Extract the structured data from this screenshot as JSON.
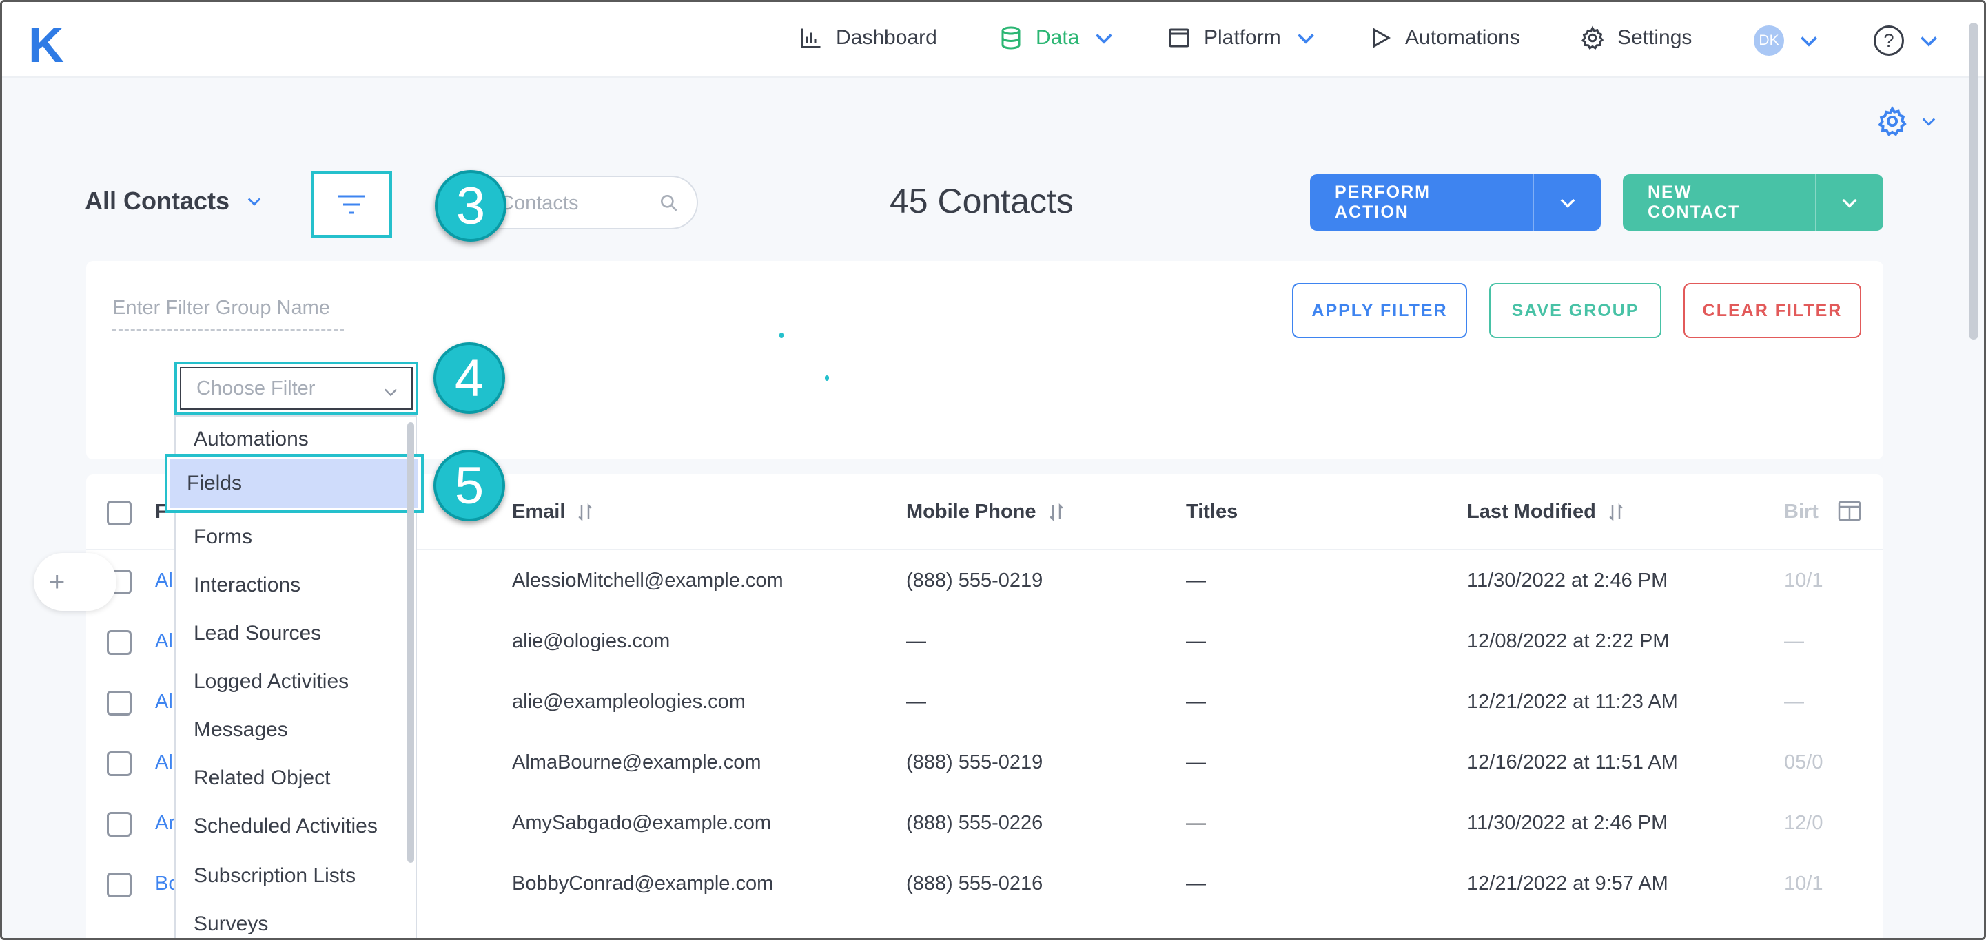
{
  "nav": {
    "logo": "K",
    "items": [
      {
        "label": "Dashboard"
      },
      {
        "label": "Data"
      },
      {
        "label": "Platform"
      },
      {
        "label": "Automations"
      },
      {
        "label": "Settings"
      }
    ],
    "avatar_initials": "DK",
    "help_glyph": "?",
    "active_color": "#2bb673",
    "accent_color": "#2f7be5"
  },
  "header": {
    "view_label": "All Contacts",
    "search_placeholder": "Contacts",
    "count_label": "45 Contacts",
    "perform_action": "PERFORM ACTION",
    "new_contact": "NEW CONTACT"
  },
  "filter": {
    "group_name_placeholder": "Enter Filter Group Name",
    "apply": "APPLY FILTER",
    "save": "SAVE GROUP",
    "clear": "CLEAR FILTER",
    "choose_placeholder": "Choose Filter",
    "menu": [
      "Automations",
      "Fields",
      "Forms",
      "Interactions",
      "Lead Sources",
      "Logged Activities",
      "Messages",
      "Related Object",
      "Scheduled Activities",
      "Subscription Lists",
      "Surveys"
    ],
    "selected": "Fields"
  },
  "badges": {
    "b3": "3",
    "b4": "4",
    "b5": "5"
  },
  "table": {
    "columns": {
      "name": "F",
      "email": "Email",
      "phone": "Mobile Phone",
      "titles": "Titles",
      "modified": "Last Modified",
      "birth": "Birt"
    },
    "plus": "+",
    "rows": [
      {
        "name": "Al",
        "email": "AlessioMitchell@example.com",
        "phone": "(888) 555-0219",
        "titles": "—",
        "modified": "11/30/2022 at 2:46 PM",
        "birth": "10/1"
      },
      {
        "name": "Al",
        "email": "alie@ologies.com",
        "phone": "—",
        "titles": "—",
        "modified": "12/08/2022 at 2:22 PM",
        "birth": "—"
      },
      {
        "name": "Al",
        "email": "alie@exampleologies.com",
        "phone": "—",
        "titles": "—",
        "modified": "12/21/2022 at 11:23 AM",
        "birth": "—"
      },
      {
        "name": "Al",
        "email": "AlmaBourne@example.com",
        "phone": "(888) 555-0219",
        "titles": "—",
        "modified": "12/16/2022 at 11:51 AM",
        "birth": "05/0"
      },
      {
        "name": "Ar",
        "email": "AmySabgado@example.com",
        "phone": "(888) 555-0226",
        "titles": "—",
        "modified": "11/30/2022 at 2:46 PM",
        "birth": "12/0"
      },
      {
        "name": "Bo",
        "email": "BobbyConrad@example.com",
        "phone": "(888) 555-0216",
        "titles": "—",
        "modified": "12/21/2022 at 9:57 AM",
        "birth": "10/1"
      }
    ]
  }
}
